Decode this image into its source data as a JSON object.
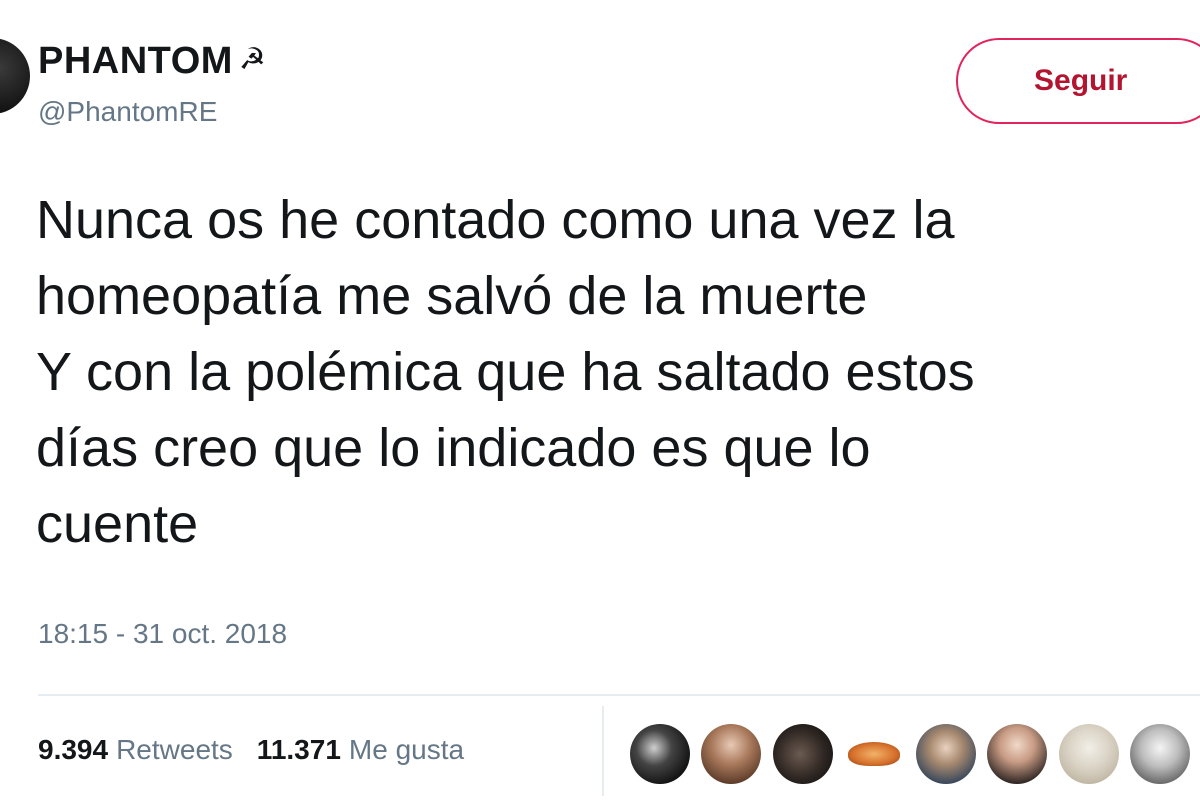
{
  "user": {
    "display_name": "PHANTOM",
    "name_emoji": "☭",
    "handle": "@PhantomRE"
  },
  "follow_button": {
    "label": "Seguir",
    "color": "#e0245e"
  },
  "tweet": {
    "lines": [
      "Nunca os he contado como una vez la",
      "homeopatía me salvó de la muerte",
      "Y con la polémica que ha saltado estos",
      "días creo que lo indicado es que lo",
      "cuente"
    ],
    "timestamp": "18:15 - 31 oct. 2018"
  },
  "stats": {
    "retweets_count": "9.394",
    "retweets_label": "Retweets",
    "likes_count": "11.371",
    "likes_label": "Me gusta"
  },
  "likers": [
    {
      "icon": "liker-avatar"
    },
    {
      "icon": "liker-avatar"
    },
    {
      "icon": "liker-avatar"
    },
    {
      "icon": "liker-avatar-moth"
    },
    {
      "icon": "liker-avatar"
    },
    {
      "icon": "liker-avatar"
    },
    {
      "icon": "liker-avatar"
    },
    {
      "icon": "liker-avatar"
    }
  ]
}
